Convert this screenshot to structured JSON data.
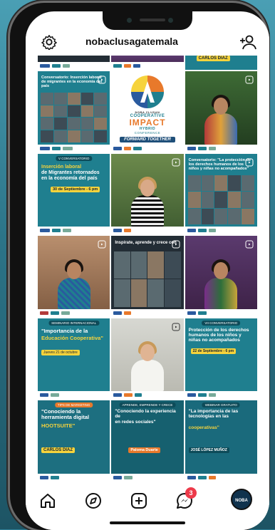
{
  "profile": {
    "username": "nobaclusagatemala",
    "avatar_text": "NOBA"
  },
  "notifications": {
    "count": "3"
  },
  "colors": {
    "brand_teal": "#1f7f8f",
    "brand_yellow": "#f6d33c",
    "impact_orange": "#e8792b",
    "badge_red": "#ed3a4a"
  },
  "posts": {
    "top_row_name": "CARLOS DIAZ",
    "r1c1_title": "Conversatorio: Inserción laboral de migrantes en la economía del país",
    "r1c2": {
      "line1": "NOBA CLUSAN",
      "line2": "COOPERATIVE",
      "line3": "IMPACT",
      "line4": "HYBRID",
      "line5": "CONFERENCE",
      "tag": "FORWARD TOGETHER"
    },
    "r2c1": {
      "banner": "V CONVERSATORIO",
      "title_a": "Inserción laboral",
      "title_b": "de Migrantes retornados en la economía del país",
      "date": "30 de Septiembre - 6 pm"
    },
    "r2c3_title": "Conversatorio: \"La protección de los derechos humanos de los niños y niñas no acompañados\"",
    "r3c2_title": "Inspírate, aprende y crece con",
    "r4c1": {
      "banner": "SEMINARIO INTERNACIONAL",
      "title_a": "\"Importancia de la",
      "title_b": "Educación Cooperativa\"",
      "date": "Jueves 21 de octubre"
    },
    "r4c3": {
      "banner": "VII CONVERSATORIO",
      "title": "Protección de los derechos humanos de los niños y niñas no acompañados",
      "date": "22 de Septiembre - 6 pm"
    },
    "r5c1": {
      "banner": "TIPS DE MARKETING",
      "title": "\"Conociendo la herramienta digital",
      "highlight": "HOOTSUITE\"",
      "name": "CARLOS DIAZ"
    },
    "r5c2": {
      "banner": "APRENDE, EMPRENDE Y CRECE",
      "title": "\"Conociendo la experiencia de",
      "title_b": "en redes sociales\"",
      "name": "Paloma Duarte"
    },
    "r5c3": {
      "banner": "WEBINAR GRATUITO",
      "title": "\"La importancia de las tecnologías en las",
      "highlight": "cooperativas\"",
      "name": "JOSÉ LÓPEZ MUÑOZ"
    }
  }
}
